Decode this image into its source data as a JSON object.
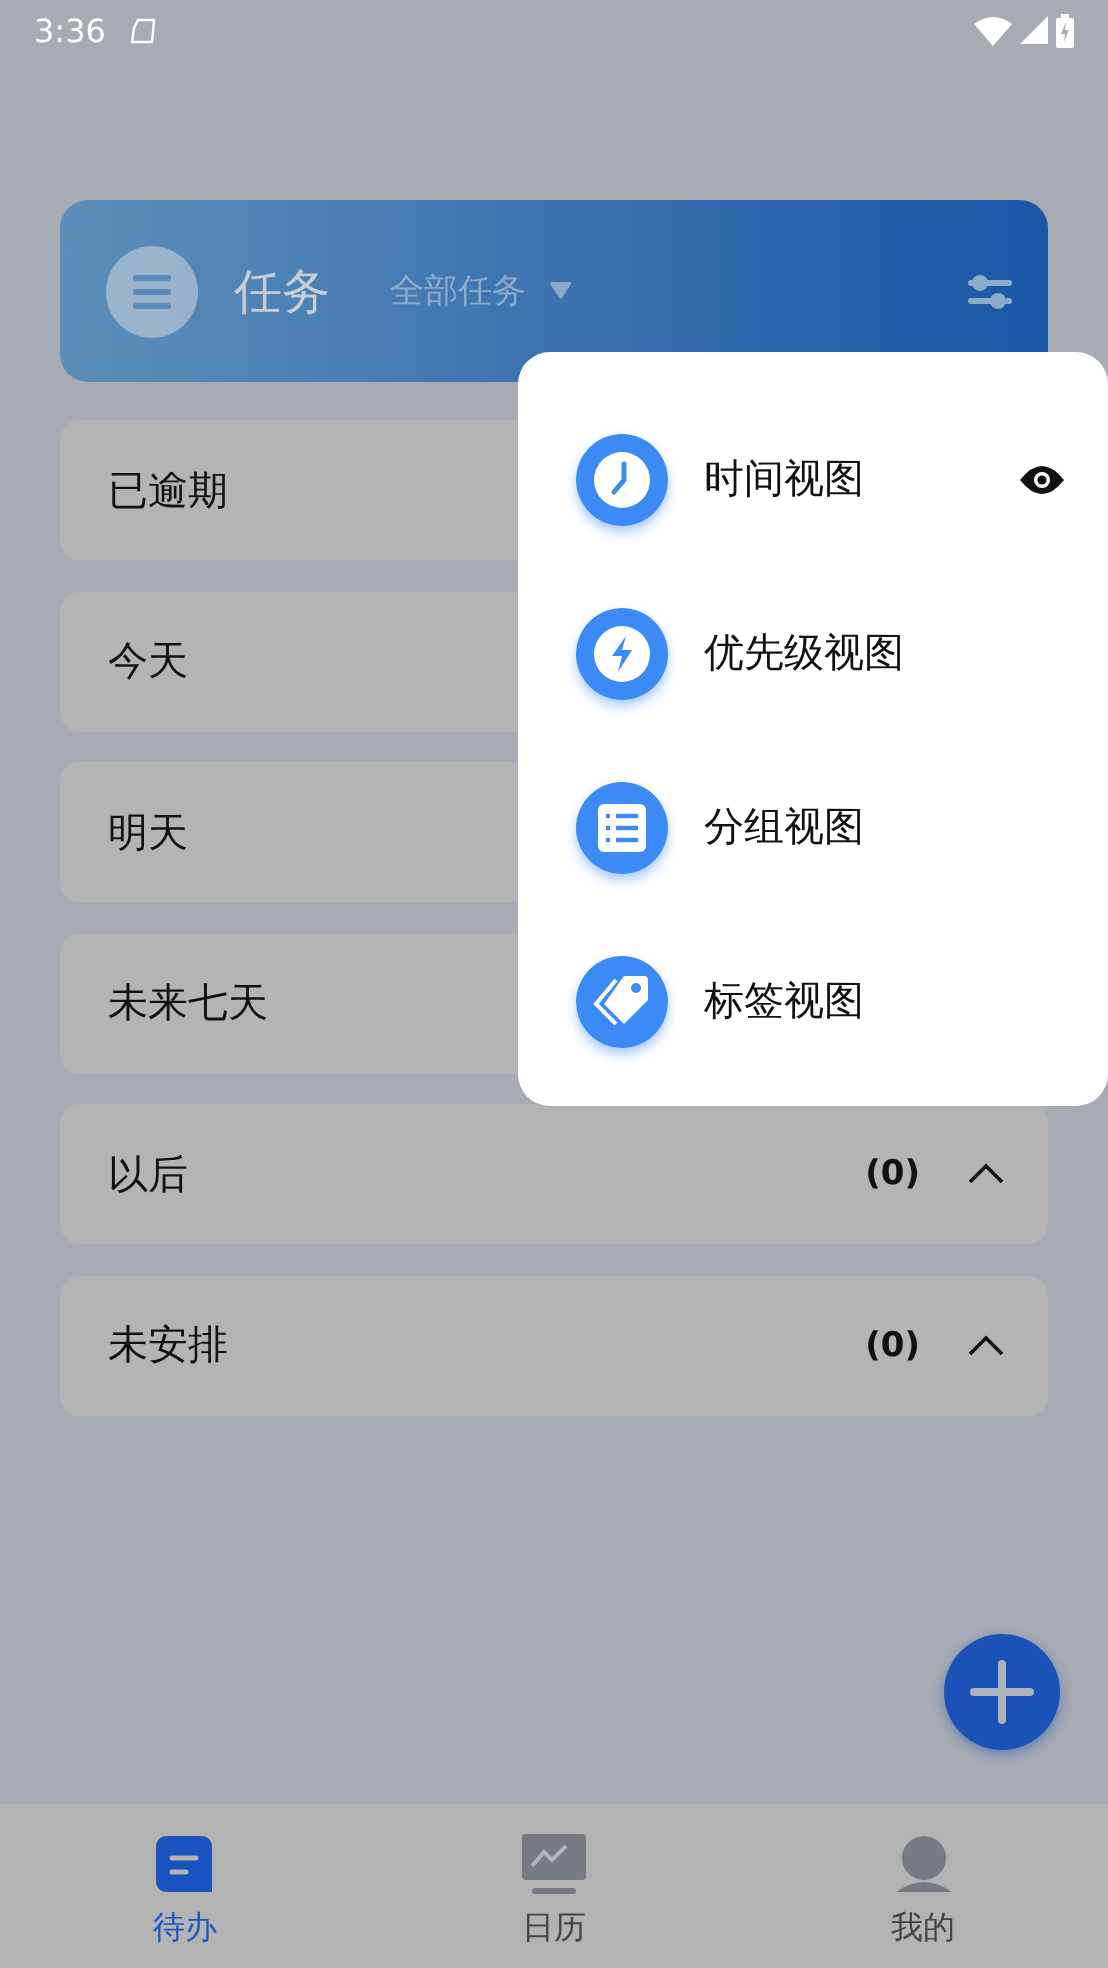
{
  "status_bar": {
    "time": "3:36"
  },
  "header": {
    "title": "任务",
    "filter": "全部任务"
  },
  "groups": [
    {
      "label": "已逾期"
    },
    {
      "label": "今天"
    },
    {
      "label": "明天"
    },
    {
      "label": "未来七天"
    },
    {
      "label": "以后",
      "count": "(0)",
      "expanded": true
    },
    {
      "label": "未安排",
      "count": "(0)",
      "expanded": true
    }
  ],
  "view_menu": [
    {
      "kind": "clock",
      "label": "时间视图",
      "selected": true
    },
    {
      "kind": "bolt",
      "label": "优先级视图",
      "selected": false
    },
    {
      "kind": "list",
      "label": "分组视图",
      "selected": false
    },
    {
      "kind": "tag",
      "label": "标签视图",
      "selected": false
    }
  ],
  "bottom_nav": [
    {
      "kind": "todo",
      "label": "待办",
      "selected": true
    },
    {
      "kind": "calendar",
      "label": "日历",
      "selected": false
    },
    {
      "kind": "profile",
      "label": "我的",
      "selected": false
    }
  ]
}
